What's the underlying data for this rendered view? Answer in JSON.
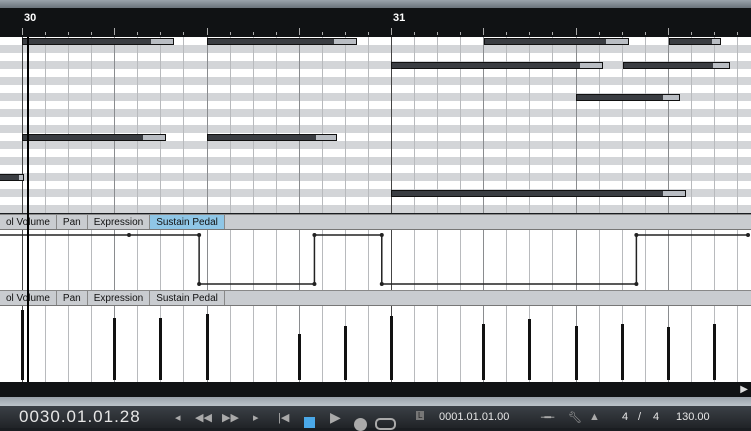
{
  "ruler": {
    "bars": [
      {
        "label": "30",
        "beat": 0
      },
      {
        "label": "31",
        "beat": 4
      }
    ]
  },
  "notes": [
    {
      "row": 0,
      "start": 0,
      "len": 1.65
    },
    {
      "row": 0,
      "start": 2,
      "len": 1.63
    },
    {
      "row": 0,
      "start": 5.01,
      "len": 1.57
    },
    {
      "row": 0,
      "start": 7.01,
      "len": 0.57
    },
    {
      "row": 3,
      "start": 4,
      "len": 2.3
    },
    {
      "row": 3,
      "start": 6.52,
      "len": 1.15
    },
    {
      "row": 7,
      "start": 6,
      "len": 1.13
    },
    {
      "row": 12,
      "start": 0,
      "len": 1.56
    },
    {
      "row": 12,
      "start": 2,
      "len": 1.41
    },
    {
      "row": 17,
      "start": -0.25,
      "len": 0.27
    },
    {
      "row": 19,
      "start": 4,
      "len": 3.2
    }
  ],
  "lane1": {
    "tabs": [
      "ol Volume",
      "Pan",
      "Expression",
      "Sustain Pedal"
    ],
    "active": 3,
    "points": [
      [
        -0.3,
        127
      ],
      [
        1.16,
        127
      ],
      [
        1.92,
        127
      ],
      [
        1.92,
        0
      ],
      [
        3.17,
        0
      ],
      [
        3.17,
        127
      ],
      [
        3.9,
        127
      ],
      [
        3.9,
        0
      ],
      [
        6.66,
        0
      ],
      [
        6.66,
        127
      ],
      [
        7.87,
        127
      ]
    ]
  },
  "lane2": {
    "tabs": [
      "ol Volume",
      "Pan",
      "Expression",
      "Sustain Pedal"
    ],
    "velocities": [
      [
        0,
        127
      ],
      [
        1,
        112
      ],
      [
        1.5,
        112
      ],
      [
        2,
        120
      ],
      [
        3,
        84
      ],
      [
        3.5,
        98
      ],
      [
        4,
        116
      ],
      [
        5,
        102
      ],
      [
        5.5,
        111
      ],
      [
        6,
        98
      ],
      [
        6.5,
        102
      ],
      [
        7,
        96
      ],
      [
        7.5,
        102
      ]
    ]
  },
  "transport": {
    "position": "0030.01.01.28",
    "locator": "0001.01.01.00",
    "signature_num": "4",
    "signature_den": "4",
    "tempo": "130.00",
    "locator_icon": "L"
  },
  "colors": {
    "active_tab": "#8fc6e6",
    "note": "#3a3d42"
  }
}
